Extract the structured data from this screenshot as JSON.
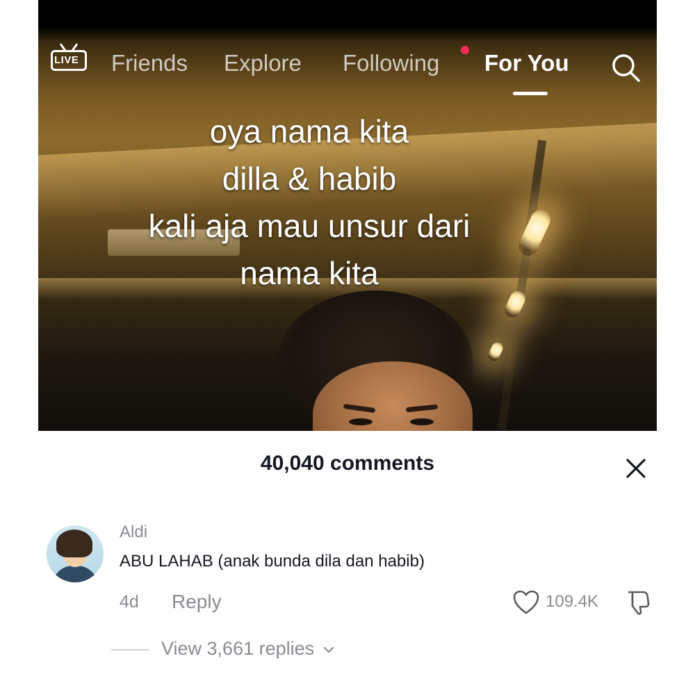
{
  "topnav": {
    "live_label": "LIVE",
    "tabs": [
      {
        "label": "Friends"
      },
      {
        "label": "Explore"
      },
      {
        "label": "Following"
      },
      {
        "label": "For You"
      }
    ],
    "active_tab": "For You",
    "following_has_notification": true,
    "notification_color": "#fe2c55"
  },
  "video": {
    "overlay_lines": [
      "oya nama kita",
      "dilla & habib",
      "kali aja mau unsur dari",
      "nama kita"
    ]
  },
  "comments": {
    "count_label": "40,040 comments",
    "items": [
      {
        "username": "Aldi",
        "text": "ABU LAHAB (anak bunda dila dan habib)",
        "time": "4d",
        "reply_label": "Reply",
        "likes": "109.4K",
        "view_replies_label": "View 3,661 replies"
      }
    ]
  },
  "icons": {
    "search": "search-icon",
    "close": "close-icon",
    "like": "heart-icon",
    "dislike": "thumbs-down-icon",
    "live": "live-tv-icon",
    "chevron": "chevron-down-icon"
  }
}
